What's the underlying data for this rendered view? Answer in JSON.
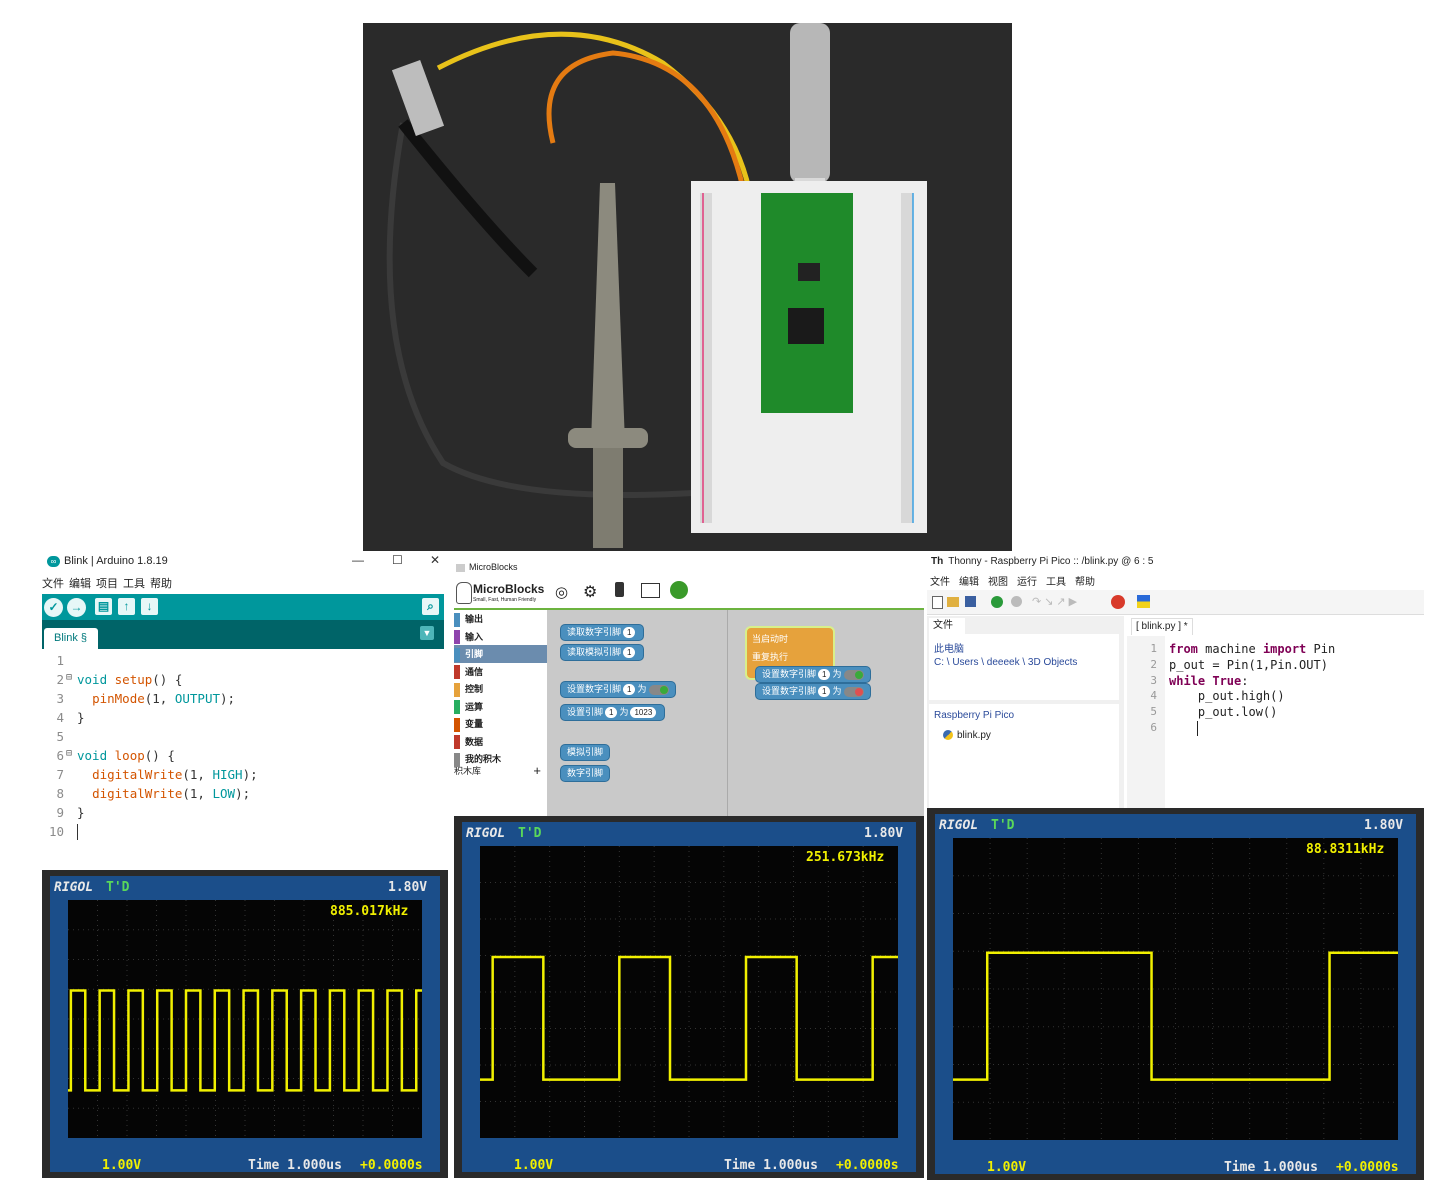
{
  "arduino": {
    "title": "Blink | Arduino 1.8.19",
    "menu": [
      "文件",
      "编辑",
      "项目",
      "工具",
      "帮助"
    ],
    "tab": "Blink §",
    "window_buttons": [
      "—",
      "☐",
      "✕"
    ],
    "lines": [
      {
        "n": "1",
        "fold": "",
        "code": ""
      },
      {
        "n": "2",
        "fold": "⊟",
        "code": "void setup() {"
      },
      {
        "n": "3",
        "fold": "",
        "code": "  pinMode(1, OUTPUT);"
      },
      {
        "n": "4",
        "fold": "",
        "code": "}"
      },
      {
        "n": "5",
        "fold": "",
        "code": ""
      },
      {
        "n": "6",
        "fold": "⊟",
        "code": "void loop() {"
      },
      {
        "n": "7",
        "fold": "",
        "code": "  digitalWrite(1, HIGH);"
      },
      {
        "n": "8",
        "fold": "",
        "code": "  digitalWrite(1, LOW);"
      },
      {
        "n": "9",
        "fold": "",
        "code": "}"
      },
      {
        "n": "10",
        "fold": "",
        "code": ""
      }
    ]
  },
  "microblocks": {
    "title": "MicroBlocks",
    "brand": "MicroBlocks",
    "tagline": "Small, Fast, Human Friendly",
    "categories": [
      {
        "label": "输出",
        "color": "#4a8fbe"
      },
      {
        "label": "输入",
        "color": "#8e44ad"
      },
      {
        "label": "引脚",
        "color": "#4a8fbe"
      },
      {
        "label": "通信",
        "color": "#c0392b"
      },
      {
        "label": "控制",
        "color": "#e6a23c"
      },
      {
        "label": "运算",
        "color": "#27ae60"
      },
      {
        "label": "变量",
        "color": "#d35400"
      },
      {
        "label": "数据",
        "color": "#c0392b"
      },
      {
        "label": "我的积木",
        "color": "#888888"
      }
    ],
    "library": "积木库",
    "library_add": "+",
    "palette": {
      "read_digital": "读取数字引脚",
      "read_analog": "读取模拟引脚",
      "set_digital": "设置数字引脚",
      "set_pin": "设置引脚",
      "to": "为",
      "pin_num": "1",
      "value_1023": "1023",
      "analog_pins": "模拟引脚",
      "digital_pins": "数字引脚"
    },
    "script": {
      "when_started": "当启动时",
      "forever": "重复执行",
      "set_digital": "设置数字引脚",
      "to": "为",
      "pin_num": "1"
    }
  },
  "thonny": {
    "title": "Thonny  -  Raspberry Pi Pico :: /blink.py  @  6 : 5",
    "menu": [
      "文件",
      "编辑",
      "视图",
      "运行",
      "工具",
      "帮助"
    ],
    "files_tab": "文件",
    "this_pc": "此电脑",
    "path": "C: \\ Users \\ deeeek \\ 3D Objects",
    "device": "Raspberry Pi Pico",
    "file": "blink.py",
    "editor_tab": "[ blink.py ] *",
    "lines": [
      {
        "n": "1",
        "code": "from machine import Pin"
      },
      {
        "n": "2",
        "code": "p_out = Pin(1,Pin.OUT)"
      },
      {
        "n": "3",
        "code": "while True:"
      },
      {
        "n": "4",
        "code": "    p_out.high()"
      },
      {
        "n": "5",
        "code": "    p_out.low()"
      },
      {
        "n": "6",
        "code": ""
      }
    ]
  },
  "scopes": [
    {
      "brand": "RIGOL",
      "mode": "T'D",
      "voltage": "1.80V",
      "freq": "885.017kHz",
      "ch": "1.00V",
      "time": "Time 1.000us",
      "offset": "+0.0000s"
    },
    {
      "brand": "RIGOL",
      "mode": "T'D",
      "voltage": "1.80V",
      "freq": "251.673kHz",
      "ch": "1.00V",
      "time": "Time 1.000us",
      "offset": "+0.0000s"
    },
    {
      "brand": "RIGOL",
      "mode": "T'D",
      "voltage": "1.80V",
      "freq": "88.8311kHz",
      "ch": "1.00V",
      "time": "Time 1.000us",
      "offset": "+0.0000s"
    }
  ],
  "colors": {
    "arduino_teal": "#00979c",
    "arduino_dark": "#006468",
    "trace": "#f1f000",
    "scope_bezel": "#1b4e8a",
    "block_blue": "#4a8fbe",
    "hat_orange": "#e6a23c"
  }
}
